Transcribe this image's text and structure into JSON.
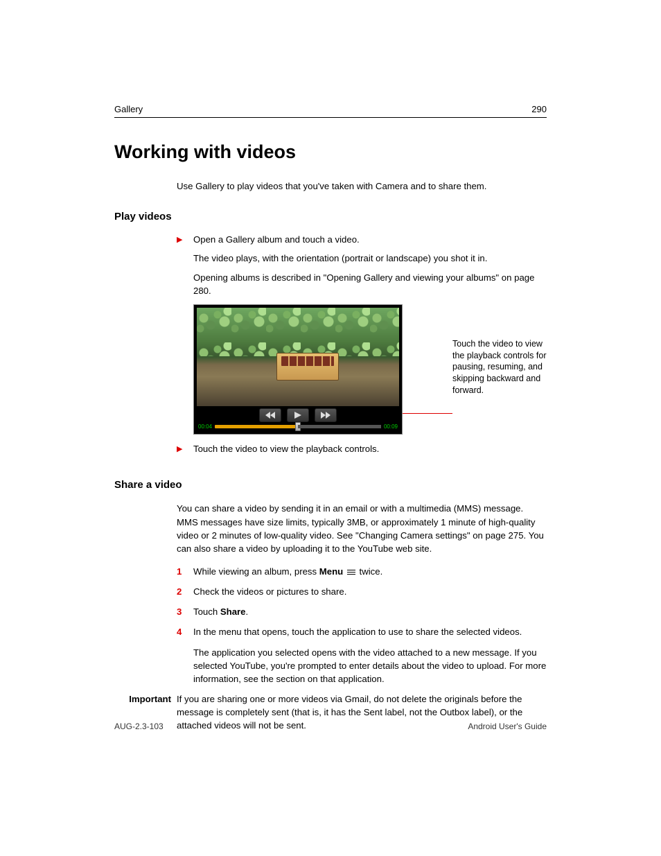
{
  "header": {
    "section": "Gallery",
    "page_number": "290"
  },
  "title": "Working with videos",
  "intro": "Use Gallery to play videos that you've taken with Camera and to share them.",
  "play": {
    "heading": "Play videos",
    "bullet1": "Open a Gallery album and touch a video.",
    "line1": "The video plays, with the orientation (portrait or landscape) you shot it in.",
    "line2": "Opening albums is described in \"Opening Gallery and viewing your albums\" on page 280.",
    "callout": "Touch the video to view the playback controls for pausing, resuming, and skipping backward and forward.",
    "bullet2": "Touch the video to view the playback controls.",
    "time_left": "00:04",
    "time_right": "00:09"
  },
  "share": {
    "heading": "Share a video",
    "para": "You can share a video by sending it in an email or with a multimedia (MMS) message. MMS messages have size limits, typically 3MB, or approximately 1 minute of high-quality video or 2 minutes of low-quality video. See \"Changing Camera settings\" on page 275. You can also share a video by uploading it to the YouTube web site.",
    "steps": {
      "s1a": "While viewing an album, press ",
      "s1_menu": "Menu",
      "s1b": " twice.",
      "s2": "Check the videos or pictures to share.",
      "s3a": "Touch ",
      "s3_share": "Share",
      "s3b": ".",
      "s4": "In the menu that opens, touch the application to use to share the selected videos.",
      "s4_after": "The application you selected opens with the video attached to a new message. If you selected YouTube, you're prompted to enter details about the video to upload. For more information, see the section on that application."
    },
    "important_label": "Important",
    "important_text": "If you are sharing one or more videos via Gmail, do not delete the originals before the message is completely sent (that is, it has the Sent label, not the Outbox label), or the attached videos will not be sent."
  },
  "footer": {
    "left": "AUG-2.3-103",
    "right": "Android User's Guide"
  },
  "numbers": {
    "n1": "1",
    "n2": "2",
    "n3": "3",
    "n4": "4"
  }
}
